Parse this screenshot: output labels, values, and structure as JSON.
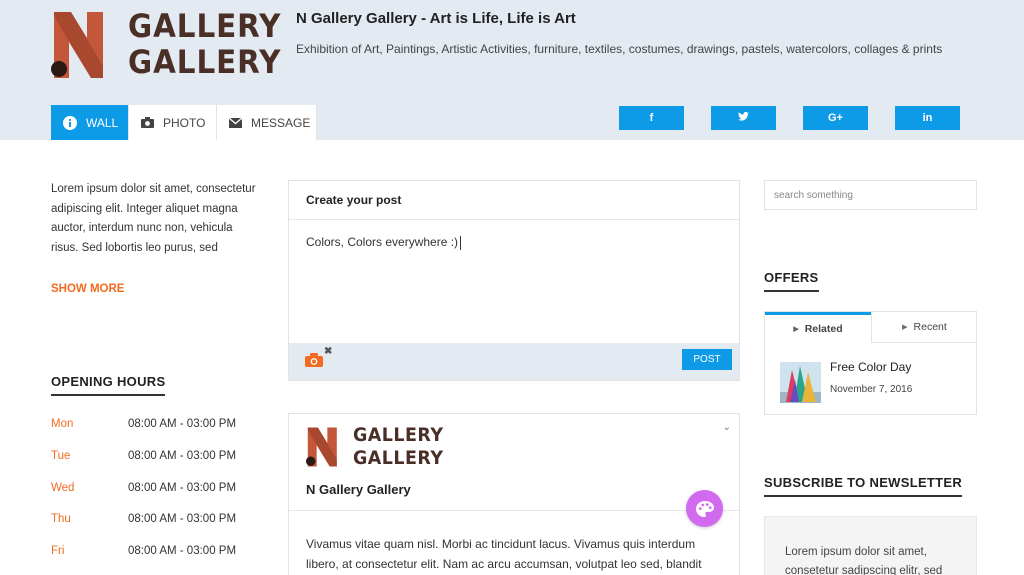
{
  "header": {
    "logo_line1": "GALLERY",
    "logo_line2": "GALLERY",
    "site_title": "N Gallery Gallery - Art is Life, Life is Art",
    "site_subtitle": "Exhibition of Art, Paintings, Artistic Activities, furniture, textiles, costumes, drawings, pastels, watercolors, collages & prints"
  },
  "tabs": [
    {
      "label": "WALL",
      "icon": "info-icon",
      "active": true
    },
    {
      "label": "PHOTO",
      "icon": "camera-icon",
      "active": false
    },
    {
      "label": "MESSAGE",
      "icon": "envelope-icon",
      "active": false
    }
  ],
  "social": [
    {
      "label": "f",
      "icon": "facebook-icon"
    },
    {
      "label": "🐦",
      "icon": "twitter-icon"
    },
    {
      "label": "G+",
      "icon": "google-plus-icon"
    },
    {
      "label": "in",
      "icon": "linkedin-icon"
    }
  ],
  "left": {
    "intro": "Lorem ipsum dolor sit amet, consectetur adipiscing elit. Integer aliquet magna auctor, interdum nunc non, vehicula risus. Sed lobortis leo purus, sed",
    "show_more": "SHOW MORE",
    "hours_title": "OPENING HOURS",
    "hours": [
      {
        "day": "Mon",
        "time": "08:00 AM - 03:00 PM"
      },
      {
        "day": "Tue",
        "time": "08:00 AM - 03:00 PM"
      },
      {
        "day": "Wed",
        "time": "08:00 AM - 03:00 PM"
      },
      {
        "day": "Thu",
        "time": "08:00 AM - 03:00 PM"
      },
      {
        "day": "Fri",
        "time": "08:00 AM - 03:00 PM"
      }
    ]
  },
  "post": {
    "heading": "Create your post",
    "text": "Colors, Colors everywhere :)",
    "post_button": "POST"
  },
  "card": {
    "logo_line1": "GALLERY",
    "logo_line2": "GALLERY",
    "name": "N Gallery Gallery",
    "body": "Vivamus vitae quam nisl. Morbi ac tincidunt lacus. Vivamus quis interdum libero, at consectetur elit. Nam ac arcu accumsan, volutpat leo sed, blandit"
  },
  "right": {
    "search_placeholder": "search something",
    "offers_title": "OFFERS",
    "offer_tabs": [
      "Related",
      "Recent"
    ],
    "offer": {
      "title": "Free Color Day",
      "date": "November 7, 2016"
    },
    "newsletter_title": "SUBSCRIBE TO NEWSLETTER",
    "newsletter_text": "Lorem ipsum dolor sit amet, consetetur sadipscing elitr, sed"
  },
  "colors": {
    "accent": "#0d9be8",
    "orange": "#f26b21",
    "brand_brown": "#4a2f27",
    "palette_button": "#d26af0"
  }
}
